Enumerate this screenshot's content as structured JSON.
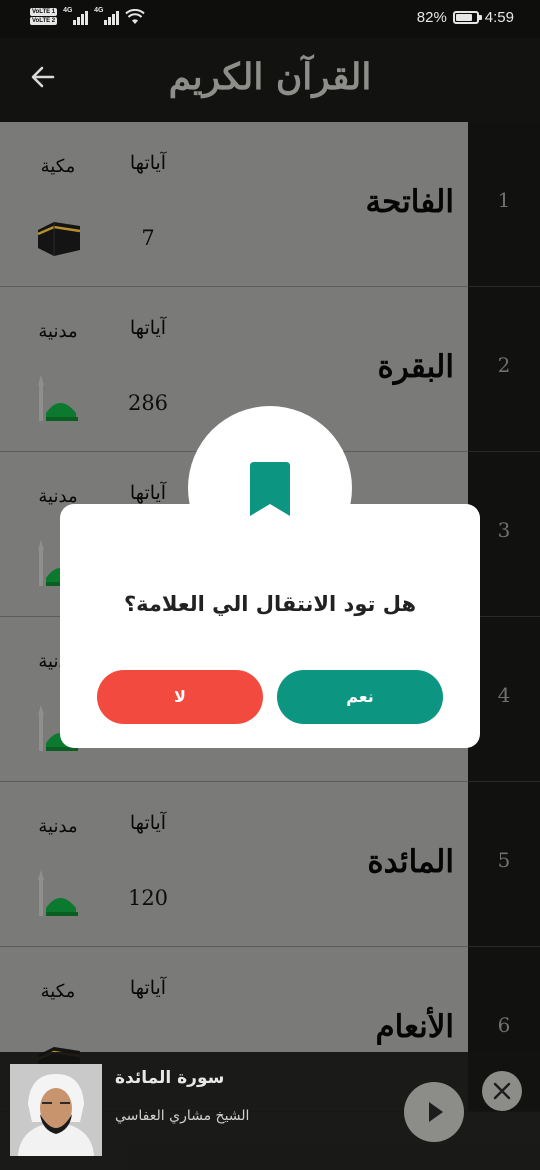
{
  "status_bar": {
    "volte_1": "VoLTE 1",
    "volte_2": "VoLTE 2",
    "network_1": "4G",
    "network_2": "4G",
    "battery_percent": "82%",
    "battery_level": 0.82,
    "time": "4:59"
  },
  "header": {
    "title": "القرآن الكريم",
    "back_icon": "arrow-left-icon"
  },
  "surahs": [
    {
      "number": "1",
      "name": "الفاتحة",
      "ayat_label": "آياتها",
      "ayat_count": "7",
      "revelation": "مكية",
      "icon": "kaaba-icon"
    },
    {
      "number": "2",
      "name": "البقرة",
      "ayat_label": "آياتها",
      "ayat_count": "286",
      "revelation": "مدنية",
      "icon": "mosque-icon"
    },
    {
      "number": "3",
      "name": "",
      "ayat_label": "آياتها",
      "ayat_count": "",
      "revelation": "مدنية",
      "icon": "mosque-icon"
    },
    {
      "number": "4",
      "name": "",
      "ayat_label": "",
      "ayat_count": "",
      "revelation": "مدنية",
      "icon": "mosque-icon"
    },
    {
      "number": "5",
      "name": "المائدة",
      "ayat_label": "آياتها",
      "ayat_count": "120",
      "revelation": "مدنية",
      "icon": "mosque-icon"
    },
    {
      "number": "6",
      "name": "الأنعام",
      "ayat_label": "آياتها",
      "ayat_count": "",
      "revelation": "مكية",
      "icon": "kaaba-icon"
    }
  ],
  "dialog": {
    "icon": "bookmark-icon",
    "message": "هل تود الانتقال الي العلامة؟",
    "yes_label": "نعم",
    "no_label": "لا",
    "colors": {
      "yes": "#0c9581",
      "no": "#f34a40",
      "bookmark": "#0c9581"
    }
  },
  "player": {
    "title": "سورة المائدة",
    "subtitle": "الشيخ مشاري العفاسي",
    "play_icon": "play-icon",
    "close_icon": "close-icon"
  }
}
